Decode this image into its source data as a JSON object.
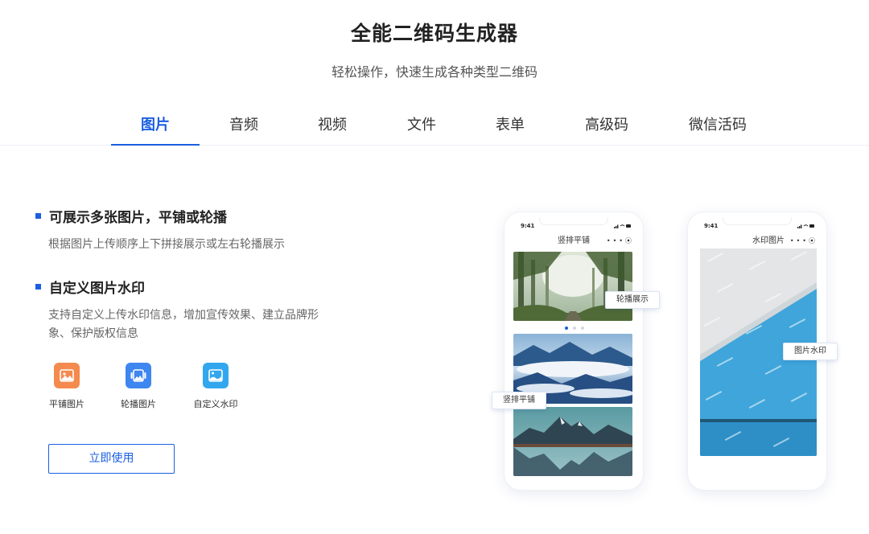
{
  "header": {
    "title": "全能二维码生成器",
    "subtitle": "轻松操作，快速生成各种类型二维码"
  },
  "tabs": [
    {
      "label": "图片",
      "active": true
    },
    {
      "label": "音频",
      "active": false
    },
    {
      "label": "视频",
      "active": false
    },
    {
      "label": "文件",
      "active": false
    },
    {
      "label": "表单",
      "active": false
    },
    {
      "label": "高级码",
      "active": false
    },
    {
      "label": "微信活码",
      "active": false
    }
  ],
  "features": [
    {
      "title": "可展示多张图片，平铺或轮播",
      "desc": "根据图片上传顺序上下拼接展示或左右轮播展示"
    },
    {
      "title": "自定义图片水印",
      "desc": "支持自定义上传水印信息，增加宣传效果、建立品牌形象、保护版权信息"
    }
  ],
  "types": [
    {
      "label": "平铺图片",
      "icon": "tile-image-icon",
      "color": "#f58a4e"
    },
    {
      "label": "轮播图片",
      "icon": "carousel-image-icon",
      "color": "#3e86f0"
    },
    {
      "label": "自定义水印",
      "icon": "watermark-image-icon",
      "color": "#33a7ee"
    }
  ],
  "cta": {
    "label": "立即使用"
  },
  "phones": {
    "left": {
      "time": "9:41",
      "title": "竖排平铺",
      "callout_top": "轮播展示",
      "callout_bottom": "竖排平铺"
    },
    "right": {
      "time": "9:41",
      "title": "水印图片",
      "callout": "图片水印"
    }
  },
  "colors": {
    "accent": "#1a5fe0"
  }
}
